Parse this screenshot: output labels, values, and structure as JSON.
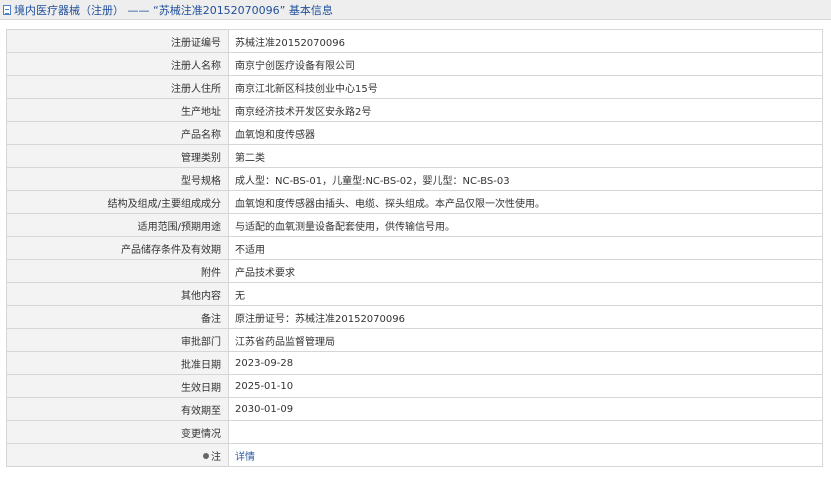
{
  "header": {
    "icon": "document-icon",
    "title": "境内医疗器械（注册） ——  “苏械注准20152070096” 基本信息"
  },
  "rows": [
    {
      "label": "注册证编号",
      "value": "苏械注准20152070096"
    },
    {
      "label": "注册人名称",
      "value": "南京宁创医疗设备有限公司"
    },
    {
      "label": "注册人住所",
      "value": "南京江北新区科技创业中心15号"
    },
    {
      "label": "生产地址",
      "value": "南京经济技术开发区安永路2号"
    },
    {
      "label": "产品名称",
      "value": "血氧饱和度传感器"
    },
    {
      "label": "管理类别",
      "value": "第二类"
    },
    {
      "label": "型号规格",
      "value": "成人型：NC-BS-01，儿童型:NC-BS-02，婴儿型：NC-BS-03"
    },
    {
      "label": "结构及组成/主要组成成分",
      "value": "血氧饱和度传感器由插头、电缆、探头组成。本产品仅限一次性使用。"
    },
    {
      "label": "适用范围/预期用途",
      "value": "与适配的血氧测量设备配套使用，供传输信号用。"
    },
    {
      "label": "产品储存条件及有效期",
      "value": "不适用"
    },
    {
      "label": "附件",
      "value": "产品技术要求"
    },
    {
      "label": "其他内容",
      "value": "无"
    },
    {
      "label": "备注",
      "value": "原注册证号：苏械注准20152070096"
    },
    {
      "label": "审批部门",
      "value": "江苏省药品监督管理局"
    },
    {
      "label": "批准日期",
      "value": "2023-09-28"
    },
    {
      "label": "生效日期",
      "value": "2025-01-10"
    },
    {
      "label": "有效期至",
      "value": "2030-01-09"
    },
    {
      "label": "变更情况",
      "value": ""
    }
  ],
  "note_row": {
    "icon": "pin-icon",
    "label": "注",
    "link_text": "详情"
  }
}
